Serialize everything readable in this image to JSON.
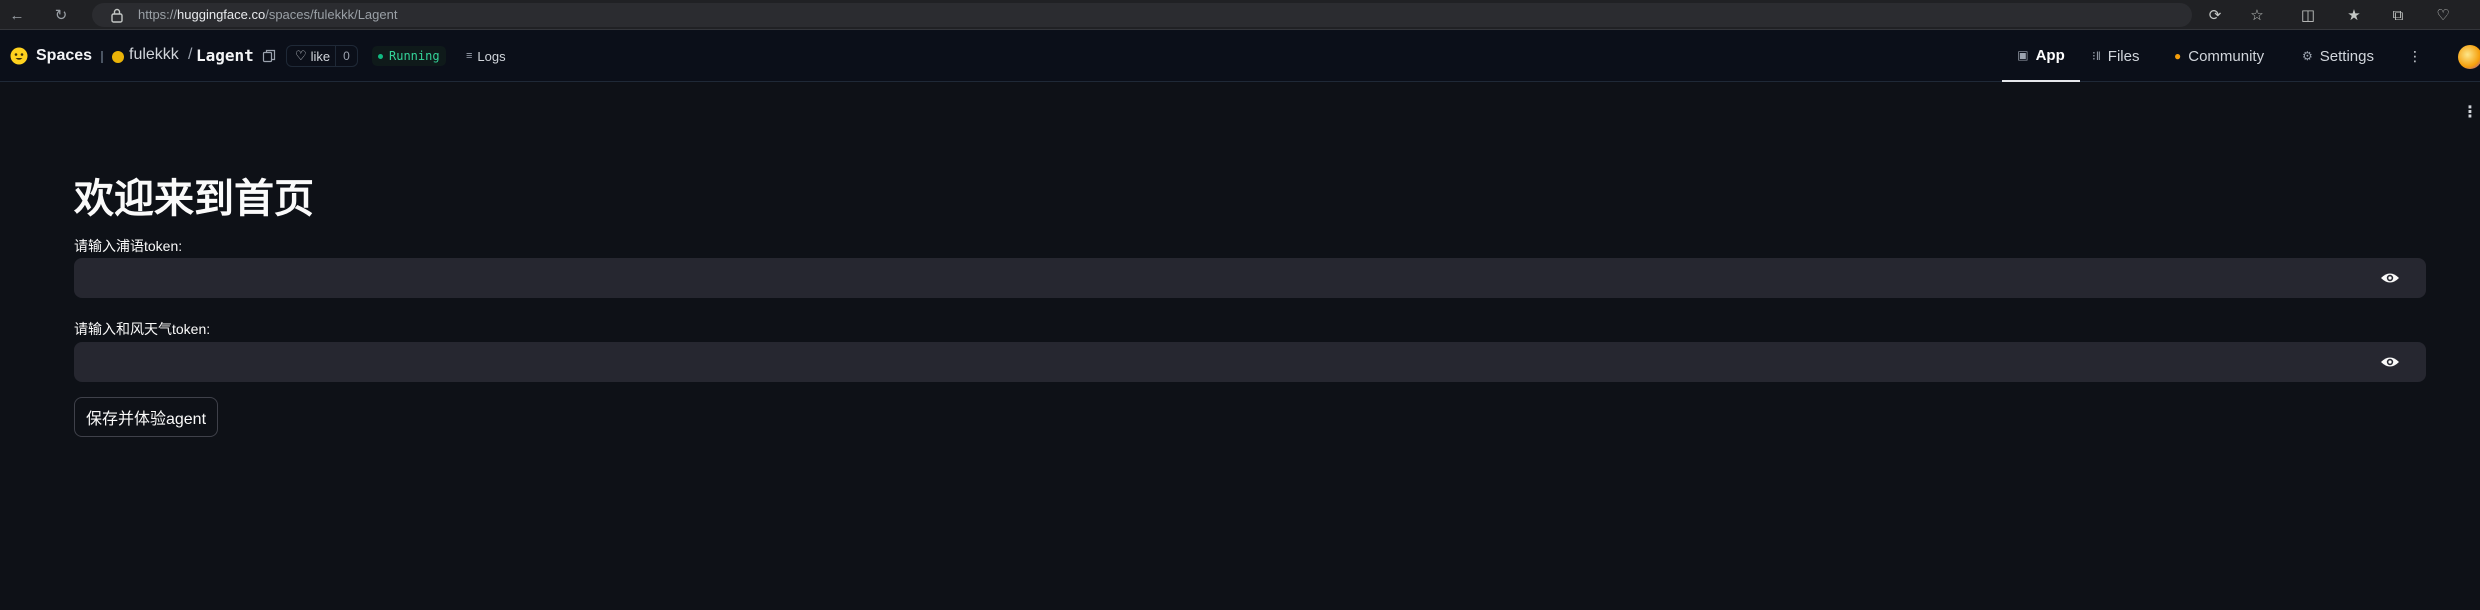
{
  "browser": {
    "url_scheme": "https://",
    "url_host": "huggingface.co",
    "url_path": "/spaces/fulekkk/Lagent"
  },
  "header": {
    "brand": "Spaces",
    "owner": "fulekkk",
    "separator": "/",
    "repo": "Lagent",
    "like_label": "like",
    "like_count": "0",
    "status": "Running",
    "logs_label": "Logs",
    "tabs": [
      {
        "label": "App",
        "icon": "cube-icon",
        "active": true
      },
      {
        "label": "Files",
        "icon": "files-icon",
        "active": false
      },
      {
        "label": "Community",
        "icon": "community-icon",
        "active": false
      },
      {
        "label": "Settings",
        "icon": "gear-icon",
        "active": false
      }
    ]
  },
  "main": {
    "title": "欢迎来到首页",
    "fields": [
      {
        "label": "请输入浦语token:",
        "value": "",
        "type": "password"
      },
      {
        "label": "请输入和风天气token:",
        "value": "",
        "type": "password"
      }
    ],
    "save_button": "保存并体验agent"
  },
  "colors": {
    "background": "#0e1117",
    "input_bg": "#262730",
    "running": "#34d399",
    "hf_yellow": "#ffd21e"
  }
}
